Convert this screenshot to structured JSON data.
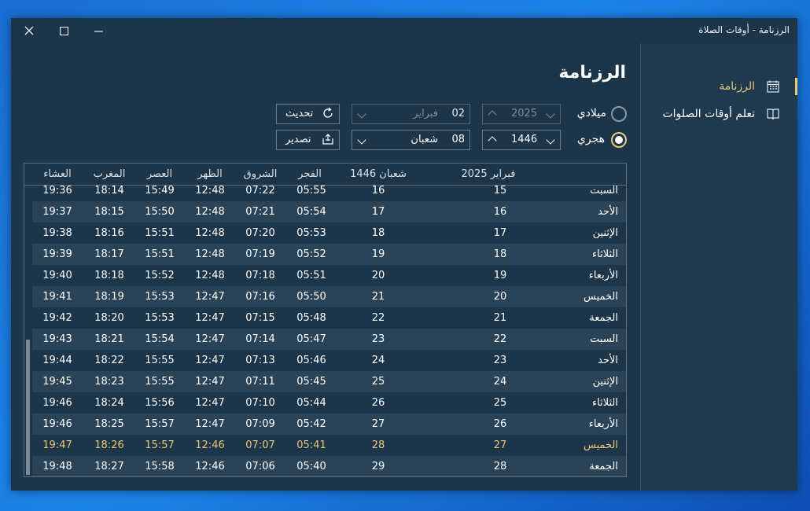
{
  "window": {
    "title": "الرزنامة - أوقات الصلاة"
  },
  "sidebar": {
    "items": [
      {
        "label": "الرزنامة",
        "icon": "calendar-icon",
        "active": true
      },
      {
        "label": "تعلم أوقات الصلوات",
        "icon": "book-icon",
        "active": false
      }
    ]
  },
  "page": {
    "title": "الرزنامة"
  },
  "controls": {
    "gregorian_label": "ميلادي",
    "hijri_label": "هجري",
    "selected": "hijri",
    "gregorian_year": "2025",
    "gregorian_month_num": "02",
    "gregorian_month_name": "فبراير",
    "hijri_year": "1446",
    "hijri_month_num": "08",
    "hijri_month_name": "شعبان",
    "refresh_label": "تحديث",
    "export_label": "تصدير"
  },
  "table": {
    "headers": {
      "gregorian": "فبراير 2025",
      "hijri": "شعبان 1446",
      "fajr": "الفجر",
      "sunrise": "الشروق",
      "dhuhr": "الظهر",
      "asr": "العصر",
      "maghrib": "المغرب",
      "isha": "العشاء"
    },
    "rows": [
      {
        "day": "السبت",
        "g": "15",
        "h": "16",
        "fajr": "05:55",
        "sunrise": "07:22",
        "dhuhr": "12:48",
        "asr": "15:49",
        "maghrib": "18:14",
        "isha": "19:36"
      },
      {
        "day": "الأحد",
        "g": "16",
        "h": "17",
        "fajr": "05:54",
        "sunrise": "07:21",
        "dhuhr": "12:48",
        "asr": "15:50",
        "maghrib": "18:15",
        "isha": "19:37"
      },
      {
        "day": "الإثنين",
        "g": "17",
        "h": "18",
        "fajr": "05:53",
        "sunrise": "07:20",
        "dhuhr": "12:48",
        "asr": "15:51",
        "maghrib": "18:16",
        "isha": "19:38"
      },
      {
        "day": "الثلاثاء",
        "g": "18",
        "h": "19",
        "fajr": "05:52",
        "sunrise": "07:19",
        "dhuhr": "12:48",
        "asr": "15:51",
        "maghrib": "18:17",
        "isha": "19:39"
      },
      {
        "day": "الأربعاء",
        "g": "19",
        "h": "20",
        "fajr": "05:51",
        "sunrise": "07:18",
        "dhuhr": "12:48",
        "asr": "15:52",
        "maghrib": "18:18",
        "isha": "19:40"
      },
      {
        "day": "الخميس",
        "g": "20",
        "h": "21",
        "fajr": "05:50",
        "sunrise": "07:16",
        "dhuhr": "12:47",
        "asr": "15:53",
        "maghrib": "18:19",
        "isha": "19:41"
      },
      {
        "day": "الجمعة",
        "g": "21",
        "h": "22",
        "fajr": "05:48",
        "sunrise": "07:15",
        "dhuhr": "12:47",
        "asr": "15:53",
        "maghrib": "18:20",
        "isha": "19:42"
      },
      {
        "day": "السبت",
        "g": "22",
        "h": "23",
        "fajr": "05:47",
        "sunrise": "07:14",
        "dhuhr": "12:47",
        "asr": "15:54",
        "maghrib": "18:21",
        "isha": "19:43"
      },
      {
        "day": "الأحد",
        "g": "23",
        "h": "24",
        "fajr": "05:46",
        "sunrise": "07:13",
        "dhuhr": "12:47",
        "asr": "15:55",
        "maghrib": "18:22",
        "isha": "19:44"
      },
      {
        "day": "الإثنين",
        "g": "24",
        "h": "25",
        "fajr": "05:45",
        "sunrise": "07:11",
        "dhuhr": "12:47",
        "asr": "15:55",
        "maghrib": "18:23",
        "isha": "19:45"
      },
      {
        "day": "الثلاثاء",
        "g": "25",
        "h": "26",
        "fajr": "05:44",
        "sunrise": "07:10",
        "dhuhr": "12:47",
        "asr": "15:56",
        "maghrib": "18:24",
        "isha": "19:46"
      },
      {
        "day": "الأربعاء",
        "g": "26",
        "h": "27",
        "fajr": "05:42",
        "sunrise": "07:09",
        "dhuhr": "12:47",
        "asr": "15:57",
        "maghrib": "18:25",
        "isha": "19:46"
      },
      {
        "day": "الخميس",
        "g": "27",
        "h": "28",
        "fajr": "05:41",
        "sunrise": "07:07",
        "dhuhr": "12:46",
        "asr": "15:57",
        "maghrib": "18:26",
        "isha": "19:47",
        "today": true
      },
      {
        "day": "الجمعة",
        "g": "28",
        "h": "29",
        "fajr": "05:40",
        "sunrise": "07:06",
        "dhuhr": "12:46",
        "asr": "15:58",
        "maghrib": "18:27",
        "isha": "19:48"
      }
    ]
  },
  "colors": {
    "accent": "#e8c87b",
    "background": "#1d3548",
    "row_alt": "#2a4356"
  }
}
